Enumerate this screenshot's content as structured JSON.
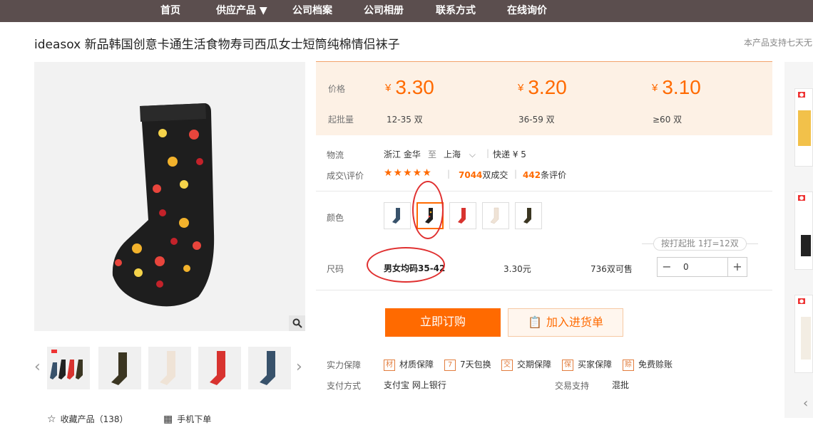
{
  "nav": {
    "items": [
      "首页",
      "供应产品 ▼",
      "公司档案",
      "公司相册",
      "联系方式",
      "在线询价"
    ]
  },
  "product": {
    "title": "ideasox 新品韩国创意卡通生活食物寿司西瓜女士短筒纯棉情侣袜子",
    "support_note": "本产品支持七天无"
  },
  "pricing": {
    "price_label": "价格",
    "batch_label": "起批量",
    "currency": "¥",
    "tiers": [
      {
        "price": "3.30",
        "range": "12-35 双"
      },
      {
        "price": "3.20",
        "range": "36-59 双"
      },
      {
        "price": "3.10",
        "range": "≥60 双"
      }
    ]
  },
  "logistics": {
    "label": "物流",
    "from": "浙江 金华",
    "to_word": "至",
    "to": "上海",
    "express": "快递 ¥ 5"
  },
  "deals": {
    "label": "成交\\评价",
    "stars": "★★★★★",
    "deals_count": "7044",
    "deals_suffix": "双成交",
    "reviews_count": "442",
    "reviews_suffix": "条评价"
  },
  "color": {
    "label": "颜色",
    "options": [
      "navy",
      "black",
      "red",
      "beige",
      "olive"
    ],
    "selected_index": 1
  },
  "size": {
    "label": "尺码",
    "batch_note": "按打起批 1打=12双",
    "value": "男女均码35-42",
    "price": "3.30元",
    "stock": "736双可售",
    "qty_value": "0",
    "minus": "−",
    "plus": "+"
  },
  "actions": {
    "buy": "立即订购",
    "cart": "加入进货单"
  },
  "guarantees": {
    "label": "实力保障",
    "items": [
      {
        "icon": "材",
        "text": "材质保障"
      },
      {
        "icon": "7",
        "text": "7天包换"
      },
      {
        "icon": "交",
        "text": "交期保障"
      },
      {
        "icon": "保",
        "text": "买家保障"
      },
      {
        "icon": "赊",
        "text": "免费赊账"
      }
    ]
  },
  "payment": {
    "label": "支付方式",
    "methods": "支付宝  网上银行",
    "trade_label": "交易支持",
    "trade_value": "混批"
  },
  "footer": {
    "favorite": "收藏产品（138）",
    "mobile": "手机下单"
  },
  "colors": {
    "accent": "#ff6a00",
    "nav_bg": "#5b4e4e",
    "annotation_red": "#e03030"
  }
}
